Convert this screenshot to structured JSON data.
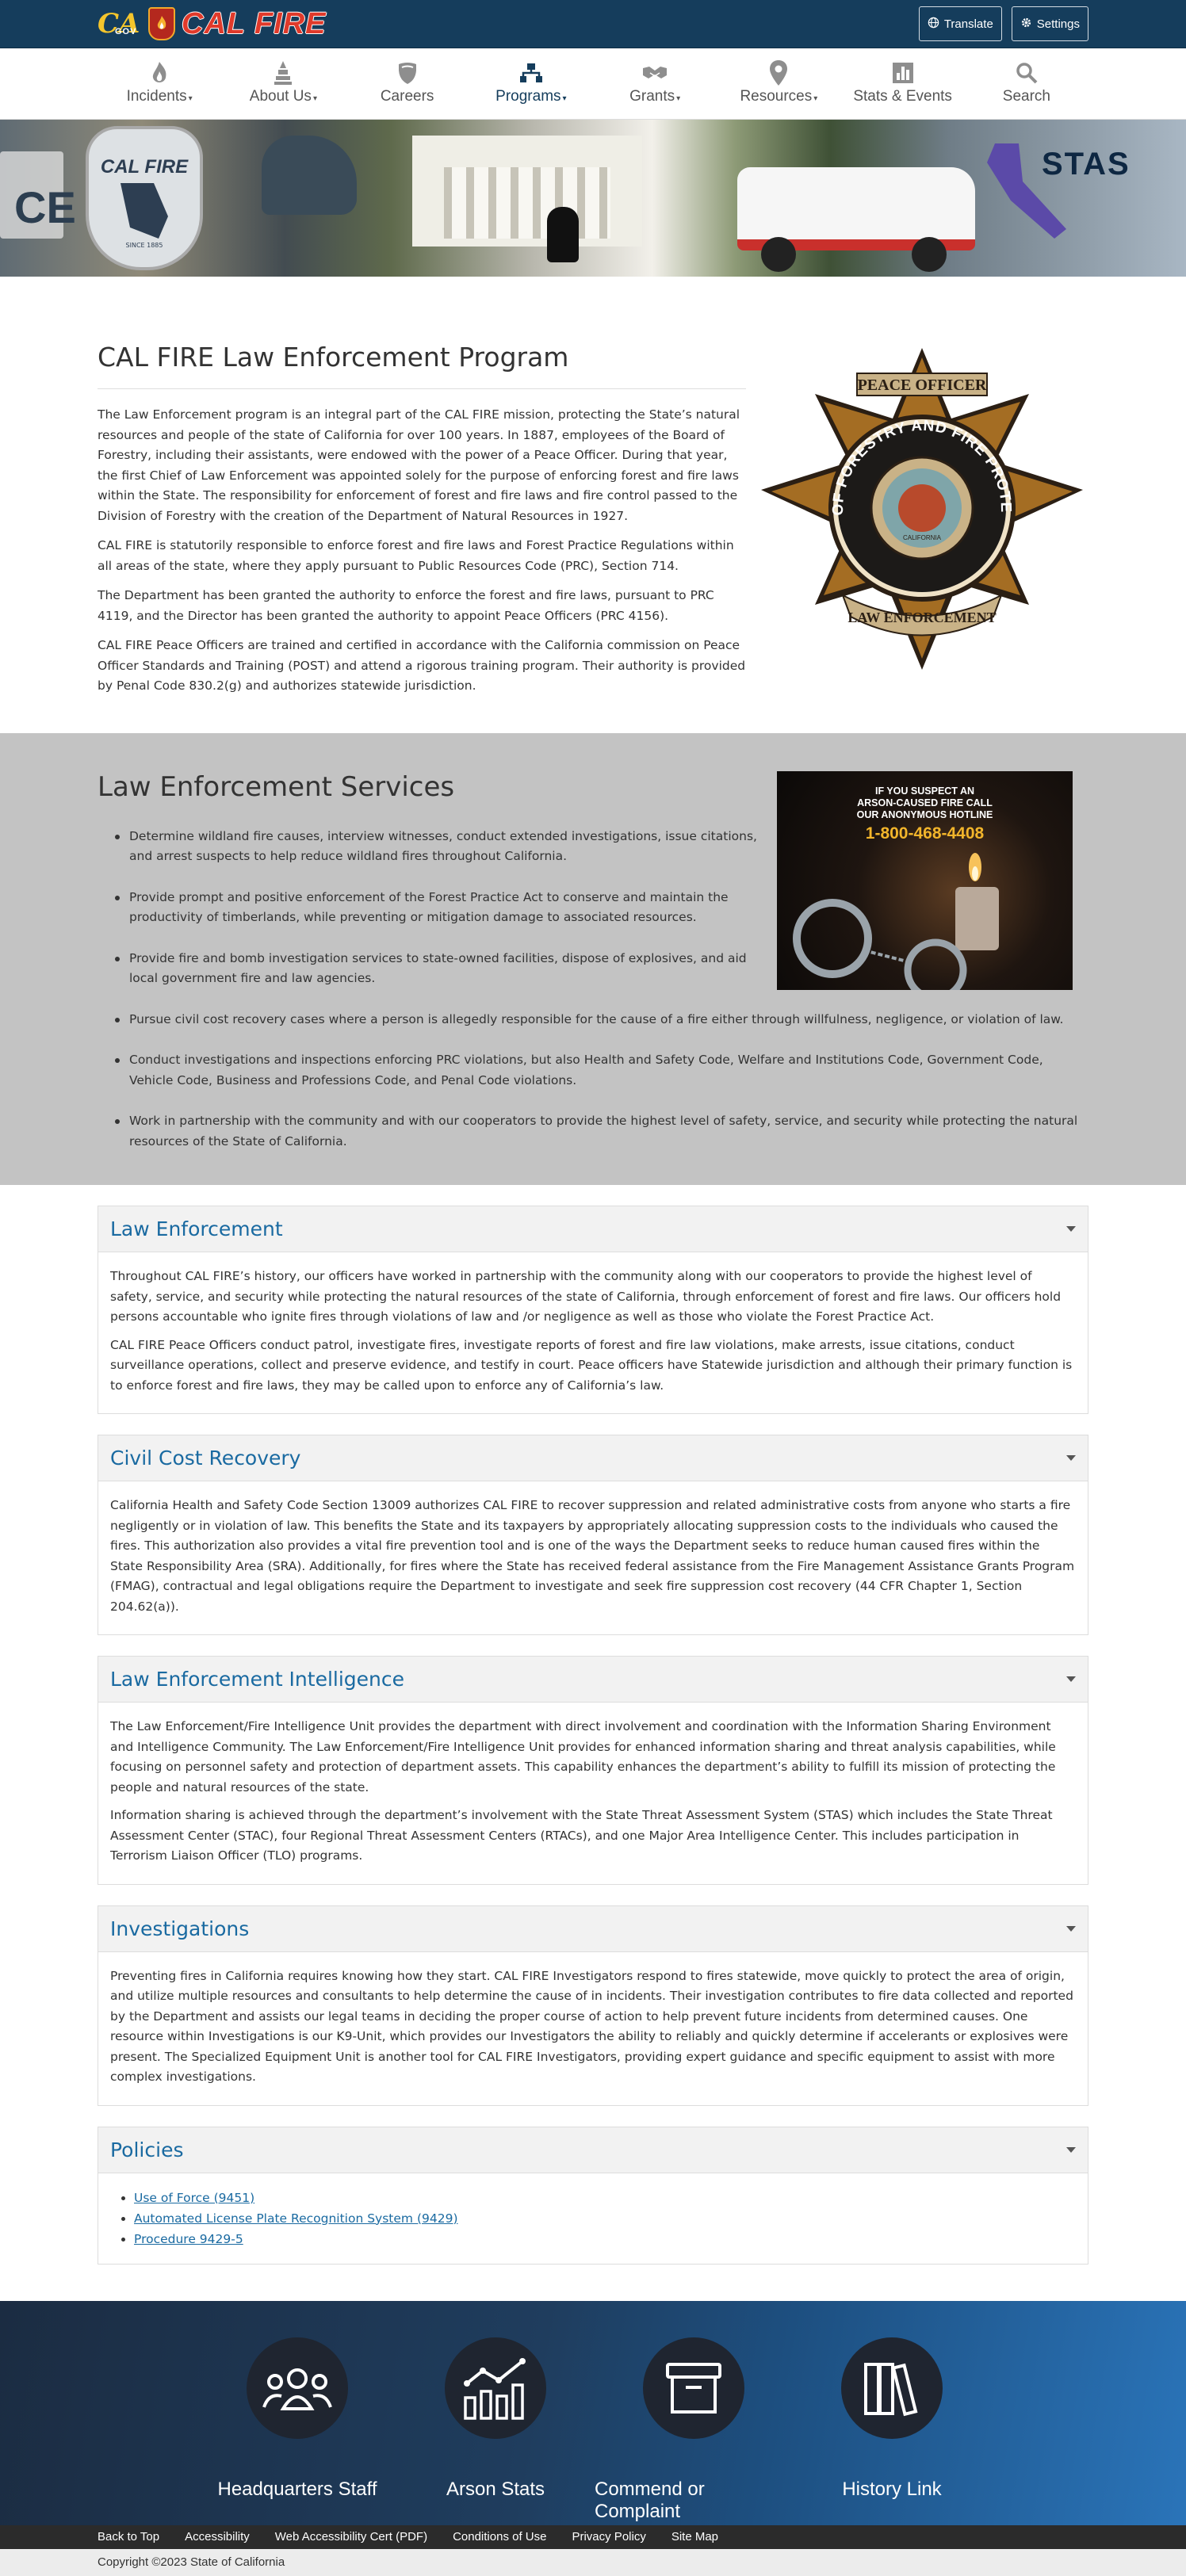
{
  "header": {
    "ca_logo_text": "CA",
    "ca_logo_sub": "GOV",
    "brand": "CAL FIRE",
    "translate_label": "Translate",
    "settings_label": "Settings"
  },
  "nav": {
    "items": [
      {
        "label": "Incidents",
        "icon": "fire-icon",
        "dropdown": true
      },
      {
        "label": "About Us",
        "icon": "building-icon",
        "dropdown": true
      },
      {
        "label": "Careers",
        "icon": "shield-icon",
        "dropdown": false
      },
      {
        "label": "Programs",
        "icon": "org-chart-icon",
        "dropdown": true,
        "active": true
      },
      {
        "label": "Grants",
        "icon": "handshake-icon",
        "dropdown": true
      },
      {
        "label": "Resources",
        "icon": "map-pin-icon",
        "dropdown": true
      },
      {
        "label": "Stats & Events",
        "icon": "bar-chart-icon",
        "dropdown": false
      },
      {
        "label": "Search",
        "icon": "search-icon",
        "dropdown": false
      }
    ]
  },
  "hero": {
    "stas_label": "STAS",
    "badge_text": "CAL FIRE",
    "badge_since": "SINCE 1885"
  },
  "intro": {
    "title": "CAL FIRE Law Enforcement Program",
    "paragraphs": [
      "The Law Enforcement program is an integral part of the CAL FIRE mission, protecting the State’s natural resources and people of the state of California for over 100 years. In 1887, employees of the Board of Forestry, including their assistants, were endowed with the power of a Peace Officer. During that year, the first Chief of Law Enforcement was appointed solely for the purpose of enforcing forest and fire laws within the State. The responsibility for enforcement of forest and fire laws and fire control passed to the Division of Forestry with the creation of the Department of Natural Resources in 1927.",
      "CAL FIRE is statutorily responsible to enforce forest and fire laws and Forest Practice Regulations within all areas of the state, where they apply pursuant to Public Resources Code (PRC), Section 714.",
      "The Department has been granted the authority to enforce the forest and fire laws, pursuant to PRC 4119, and the Director has been granted the authority to appoint Peace Officers (PRC 4156).",
      "CAL FIRE Peace Officers are trained and certified in accordance with the California commission on Peace Officer Standards and Training (POST) and attend a rigorous training program. Their authority is provided by Penal Code 830.2(g) and authorizes statewide jurisdiction."
    ],
    "badge": {
      "top": "PEACE OFFICER",
      "ring": "DEPT OF FORESTRY AND FIRE PROTECTION",
      "bottom": "LAW ENFORCEMENT",
      "seal": "CALIFORNIA"
    }
  },
  "services": {
    "title": "Law Enforcement Services",
    "items": [
      "Determine wildland fire causes, interview witnesses, conduct extended investigations, issue citations, and arrest suspects to help reduce wildland fires throughout California.",
      "Provide prompt and positive enforcement of the Forest Practice Act to conserve and maintain the productivity of timberlands, while preventing or mitigation damage to associated resources.",
      "Provide fire and bomb investigation services to state-owned facilities, dispose of explosives, and aid local government fire and law agencies.",
      "Pursue civil cost recovery cases where a person is allegedly responsible for the cause of a fire either through willfulness, negligence, or violation of law.",
      "Conduct investigations and inspections enforcing PRC violations, but also Health and Safety Code, Welfare and Institutions Code, Government Code, Vehicle Code, Business and Professions Code, and Penal Code violations.",
      "Work in partnership with the community and with our cooperators to provide the highest level of safety, service, and security while protecting the natural resources of the State of California."
    ],
    "image": {
      "line1": "IF YOU SUSPECT AN",
      "line2": "ARSON-CAUSED FIRE CALL",
      "line3": "OUR ANONYMOUS HOTLINE",
      "phone": "1-800-468-4408"
    }
  },
  "accordions": [
    {
      "title": "Law Enforcement",
      "paragraphs": [
        "Throughout CAL FIRE’s history, our officers have worked in partnership with the community along with our cooperators to provide the highest level of safety, service, and security while protecting the natural resources of the state of California, through enforcement of forest and fire laws. Our officers hold persons accountable who ignite fires through violations of law and /or negligence as well as those who violate the Forest Practice Act.",
        "CAL FIRE Peace Officers conduct patrol, investigate fires, investigate reports of forest and fire law violations, make arrests, issue citations, conduct surveillance operations, collect and preserve evidence, and testify in court. Peace officers have Statewide jurisdiction and although their primary function is to enforce forest and fire laws, they may be called upon to enforce any of California’s law."
      ]
    },
    {
      "title": "Civil Cost Recovery",
      "paragraphs": [
        "California Health and Safety Code Section 13009 authorizes CAL FIRE to recover suppression and related administrative costs from anyone who starts a fire negligently or in violation of law. This benefits the State and its taxpayers by appropriately allocating suppression costs to the individuals who caused the fires. This authorization also provides a vital fire prevention tool and is one of the ways the Department seeks to reduce human caused fires within the State Responsibility Area (SRA). Additionally, for fires where the State has received federal assistance from the Fire Management Assistance Grants Program (FMAG), contractual and legal obligations require the Department to investigate and seek fire suppression cost recovery (44 CFR Chapter 1, Section 204.62(a))."
      ]
    },
    {
      "title": "Law Enforcement Intelligence",
      "paragraphs": [
        "The Law Enforcement/Fire Intelligence Unit provides the department with direct involvement and coordination with the Information Sharing Environment and Intelligence Community. The Law Enforcement/Fire Intelligence Unit provides for enhanced information sharing and threat analysis capabilities, while focusing on personnel safety and protection of department assets. This capability enhances the department’s ability to fulfill its mission of protecting the people and natural resources of the state.",
        "Information sharing is achieved through the department’s involvement with the State Threat Assessment System (STAS) which includes the State Threat Assessment Center (STAC), four Regional Threat Assessment Centers (RTACs), and one Major Area Intelligence Center. This includes participation in Terrorism Liaison Officer (TLO) programs."
      ]
    },
    {
      "title": "Investigations",
      "paragraphs": [
        "Preventing fires in California requires knowing how they start. CAL FIRE Investigators respond to fires statewide, move quickly to protect the area of origin, and utilize multiple resources and consultants to help determine the cause of in incidents. Their investigation contributes to fire data collected and reported by the Department and assists our legal teams in deciding the proper course of action to help prevent future incidents from determined causes. One resource within Investigations is our K9-Unit, which provides our Investigators the ability to reliably and quickly determine if accelerants or explosives were present. The Specialized Equipment Unit is another tool for CAL FIRE Investigators, providing expert guidance and specific equipment to assist with more complex investigations."
      ]
    }
  ],
  "policies": {
    "title": "Policies",
    "links": [
      "Use of Force (9451)",
      "Automated License Plate Recognition System (9429)",
      "Procedure 9429-5"
    ]
  },
  "footer": {
    "links": [
      {
        "label": "Headquarters Staff",
        "icon": "people-icon"
      },
      {
        "label": "Arson Stats",
        "icon": "line-chart-icon"
      },
      {
        "label": "Commend or Complaint",
        "icon": "archive-box-icon"
      },
      {
        "label": "History Link",
        "icon": "books-icon"
      }
    ],
    "bar_links": [
      "Back to Top",
      "Accessibility",
      "Web Accessibility Cert (PDF)",
      "Conditions of Use",
      "Privacy Policy",
      "Site Map"
    ],
    "copyright": "Copyright ©2023 State of California"
  }
}
